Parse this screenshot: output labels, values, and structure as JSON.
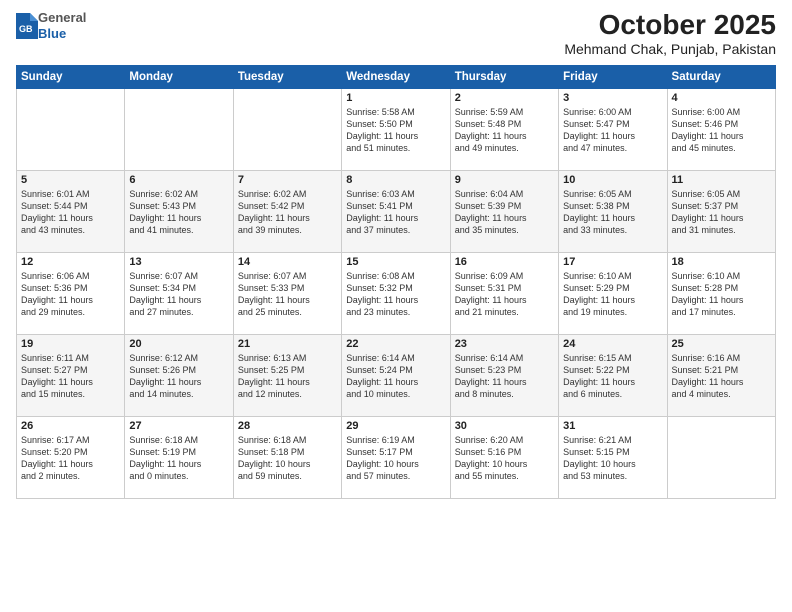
{
  "header": {
    "logo": {
      "general": "General",
      "blue": "Blue"
    },
    "title": "October 2025",
    "subtitle": "Mehmand Chak, Punjab, Pakistan"
  },
  "days_of_week": [
    "Sunday",
    "Monday",
    "Tuesday",
    "Wednesday",
    "Thursday",
    "Friday",
    "Saturday"
  ],
  "weeks": [
    [
      {
        "day": "",
        "content": ""
      },
      {
        "day": "",
        "content": ""
      },
      {
        "day": "",
        "content": ""
      },
      {
        "day": "1",
        "content": "Sunrise: 5:58 AM\nSunset: 5:50 PM\nDaylight: 11 hours\nand 51 minutes."
      },
      {
        "day": "2",
        "content": "Sunrise: 5:59 AM\nSunset: 5:48 PM\nDaylight: 11 hours\nand 49 minutes."
      },
      {
        "day": "3",
        "content": "Sunrise: 6:00 AM\nSunset: 5:47 PM\nDaylight: 11 hours\nand 47 minutes."
      },
      {
        "day": "4",
        "content": "Sunrise: 6:00 AM\nSunset: 5:46 PM\nDaylight: 11 hours\nand 45 minutes."
      }
    ],
    [
      {
        "day": "5",
        "content": "Sunrise: 6:01 AM\nSunset: 5:44 PM\nDaylight: 11 hours\nand 43 minutes."
      },
      {
        "day": "6",
        "content": "Sunrise: 6:02 AM\nSunset: 5:43 PM\nDaylight: 11 hours\nand 41 minutes."
      },
      {
        "day": "7",
        "content": "Sunrise: 6:02 AM\nSunset: 5:42 PM\nDaylight: 11 hours\nand 39 minutes."
      },
      {
        "day": "8",
        "content": "Sunrise: 6:03 AM\nSunset: 5:41 PM\nDaylight: 11 hours\nand 37 minutes."
      },
      {
        "day": "9",
        "content": "Sunrise: 6:04 AM\nSunset: 5:39 PM\nDaylight: 11 hours\nand 35 minutes."
      },
      {
        "day": "10",
        "content": "Sunrise: 6:05 AM\nSunset: 5:38 PM\nDaylight: 11 hours\nand 33 minutes."
      },
      {
        "day": "11",
        "content": "Sunrise: 6:05 AM\nSunset: 5:37 PM\nDaylight: 11 hours\nand 31 minutes."
      }
    ],
    [
      {
        "day": "12",
        "content": "Sunrise: 6:06 AM\nSunset: 5:36 PM\nDaylight: 11 hours\nand 29 minutes."
      },
      {
        "day": "13",
        "content": "Sunrise: 6:07 AM\nSunset: 5:34 PM\nDaylight: 11 hours\nand 27 minutes."
      },
      {
        "day": "14",
        "content": "Sunrise: 6:07 AM\nSunset: 5:33 PM\nDaylight: 11 hours\nand 25 minutes."
      },
      {
        "day": "15",
        "content": "Sunrise: 6:08 AM\nSunset: 5:32 PM\nDaylight: 11 hours\nand 23 minutes."
      },
      {
        "day": "16",
        "content": "Sunrise: 6:09 AM\nSunset: 5:31 PM\nDaylight: 11 hours\nand 21 minutes."
      },
      {
        "day": "17",
        "content": "Sunrise: 6:10 AM\nSunset: 5:29 PM\nDaylight: 11 hours\nand 19 minutes."
      },
      {
        "day": "18",
        "content": "Sunrise: 6:10 AM\nSunset: 5:28 PM\nDaylight: 11 hours\nand 17 minutes."
      }
    ],
    [
      {
        "day": "19",
        "content": "Sunrise: 6:11 AM\nSunset: 5:27 PM\nDaylight: 11 hours\nand 15 minutes."
      },
      {
        "day": "20",
        "content": "Sunrise: 6:12 AM\nSunset: 5:26 PM\nDaylight: 11 hours\nand 14 minutes."
      },
      {
        "day": "21",
        "content": "Sunrise: 6:13 AM\nSunset: 5:25 PM\nDaylight: 11 hours\nand 12 minutes."
      },
      {
        "day": "22",
        "content": "Sunrise: 6:14 AM\nSunset: 5:24 PM\nDaylight: 11 hours\nand 10 minutes."
      },
      {
        "day": "23",
        "content": "Sunrise: 6:14 AM\nSunset: 5:23 PM\nDaylight: 11 hours\nand 8 minutes."
      },
      {
        "day": "24",
        "content": "Sunrise: 6:15 AM\nSunset: 5:22 PM\nDaylight: 11 hours\nand 6 minutes."
      },
      {
        "day": "25",
        "content": "Sunrise: 6:16 AM\nSunset: 5:21 PM\nDaylight: 11 hours\nand 4 minutes."
      }
    ],
    [
      {
        "day": "26",
        "content": "Sunrise: 6:17 AM\nSunset: 5:20 PM\nDaylight: 11 hours\nand 2 minutes."
      },
      {
        "day": "27",
        "content": "Sunrise: 6:18 AM\nSunset: 5:19 PM\nDaylight: 11 hours\nand 0 minutes."
      },
      {
        "day": "28",
        "content": "Sunrise: 6:18 AM\nSunset: 5:18 PM\nDaylight: 10 hours\nand 59 minutes."
      },
      {
        "day": "29",
        "content": "Sunrise: 6:19 AM\nSunset: 5:17 PM\nDaylight: 10 hours\nand 57 minutes."
      },
      {
        "day": "30",
        "content": "Sunrise: 6:20 AM\nSunset: 5:16 PM\nDaylight: 10 hours\nand 55 minutes."
      },
      {
        "day": "31",
        "content": "Sunrise: 6:21 AM\nSunset: 5:15 PM\nDaylight: 10 hours\nand 53 minutes."
      },
      {
        "day": "",
        "content": ""
      }
    ]
  ]
}
